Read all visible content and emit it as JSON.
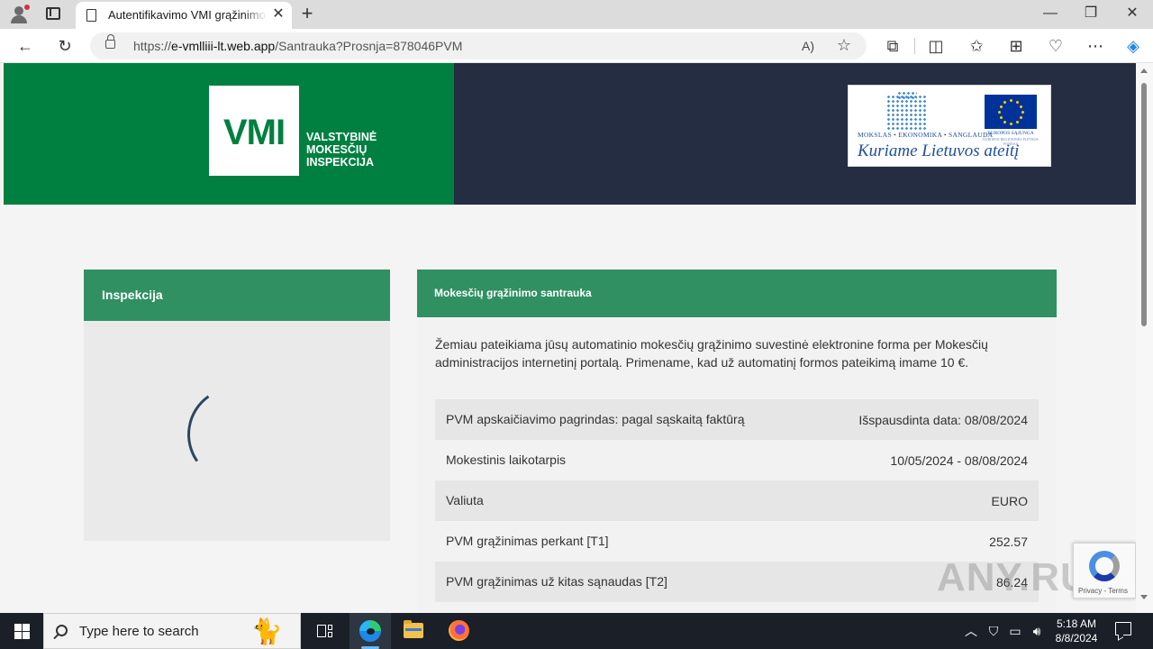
{
  "browser": {
    "tab_title": "Autentifikavimo VMI grąžinimo sąskaita",
    "tab_close": "✕",
    "new_tab": "+",
    "url_prefix": "https://",
    "url_host": "e-vmlliii-lt.web.app",
    "url_path": "/Santrauka?Prosnja=878046PVM",
    "win_min": "—",
    "win_max": "❐",
    "win_close": "✕",
    "read_aloud": "A)",
    "favorite": "☆"
  },
  "header": {
    "logo_letters": "VMI",
    "logo_name": [
      "VALSTYBINĖ",
      "MOKESČIŲ",
      "INSPEKCIJA"
    ],
    "eu_tagline": "MOKSLAS • EKONOMIKA • SANGLAUDA",
    "eu_union": "EUROPOS SĄJUNGA",
    "eu_fund": "EUROPOS REGIONINĖS PLĖTROS FONDAS",
    "eu_motto": "Kuriame Lietuvos ateitį",
    "colors": {
      "green": "#008040",
      "navy": "#242d42",
      "card_head": "#309062"
    }
  },
  "left_card": {
    "title": "Inspekcija"
  },
  "right_card": {
    "title": "Mokesčių grąžinimo santrauka",
    "intro": "Žemiau pateikiama jūsų automatinio mokesčių grąžinimo suvestinė elektronine forma per Mokesčių administracijos internetinį portalą. Primename, kad už automatinį formos pateikimą imame 10 €.",
    "rows": [
      {
        "label": "PVM apskaičiavimo pagrindas: pagal sąskaitą faktūrą",
        "value": "Išspausdinta data: 08/08/2024"
      },
      {
        "label": "Mokestinis laikotarpis",
        "value": "10/05/2024 - 08/08/2024"
      },
      {
        "label": "Valiuta",
        "value": "EURO"
      },
      {
        "label": "PVM grąžinimas perkant [T1]",
        "value": "252.57"
      },
      {
        "label": "PVM grąžinimas už kitas sąnaudas [T2]",
        "value": "86.24"
      }
    ]
  },
  "recaptcha": {
    "terms": "Privacy - Terms"
  },
  "watermark": "ANY.RUN",
  "taskbar": {
    "search_placeholder": "Type here to search",
    "time": "5:18 AM",
    "date": "8/8/2024"
  }
}
